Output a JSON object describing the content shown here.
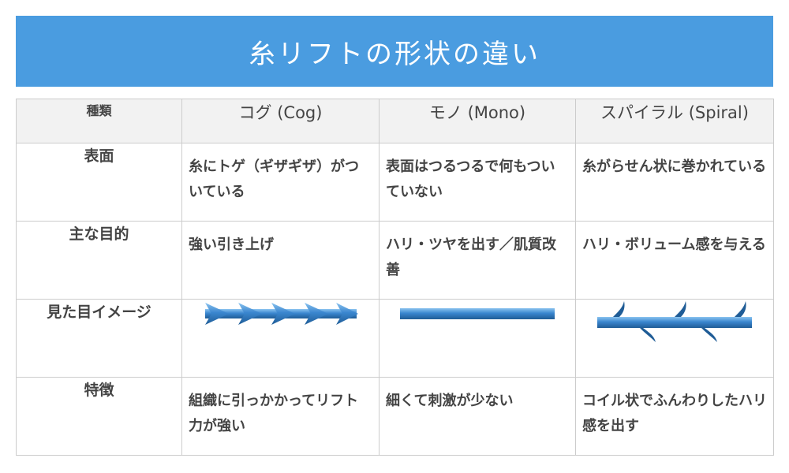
{
  "banner": {
    "title": "糸リフトの形状の違い"
  },
  "table": {
    "corner": "種類",
    "columns": [
      "コグ (Cog)",
      "モノ (Mono)",
      "スパイラル (Spiral)"
    ],
    "rows": [
      {
        "label": "表面",
        "cells": [
          "糸にトゲ（ギザギザ）がついている",
          "表面はつるつるで何もついていない",
          "糸がらせん状に巻かれている"
        ]
      },
      {
        "label": "主な目的",
        "cells": [
          "強い引き上げ",
          "ハリ・ツヤを出す／肌質改善",
          "ハリ・ボリューム感を与える"
        ]
      },
      {
        "label": "見た目イメージ"
      },
      {
        "label": "特徴",
        "cells": [
          "組織に引っかかってリフト力が強い",
          "細くて刺激が少ない",
          "コイル状でふんわりしたハリ感を出す"
        ]
      }
    ]
  },
  "colors": {
    "banner": "#4a9ce0",
    "thread": "#3a86cf"
  },
  "icons": [
    "cog-thread-icon",
    "mono-thread-icon",
    "spiral-thread-icon"
  ]
}
